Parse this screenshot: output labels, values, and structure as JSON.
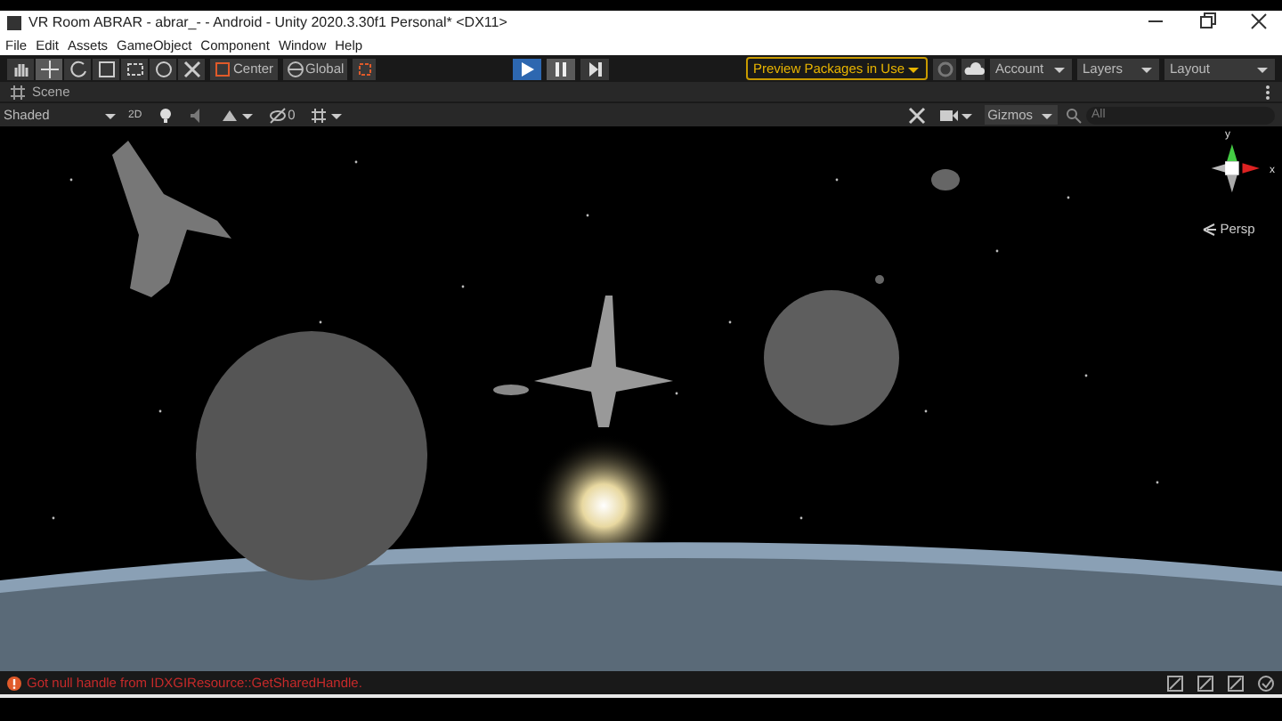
{
  "window": {
    "title": "VR Room ABRAR - abrar_- - Android - Unity 2020.3.30f1 Personal* <DX11>"
  },
  "menu": [
    "File",
    "Edit",
    "Assets",
    "GameObject",
    "Component",
    "Window",
    "Help"
  ],
  "toolbar": {
    "pivot": "Center",
    "space": "Global",
    "play": {
      "playing": true
    },
    "pause": {
      "paused": true
    },
    "preview_packages": "Preview Packages in Use",
    "account": "Account",
    "layers": "Layers",
    "layout": "Layout"
  },
  "scene_tab": {
    "label": "Scene"
  },
  "scene_toolbar": {
    "draw_mode": "Shaded",
    "mode_2d": "2D",
    "hidden_count": "0",
    "gizmos": "Gizmos",
    "search": {
      "placeholder": "All"
    }
  },
  "orientation_gizmo": {
    "y_label": "y",
    "x_label": "x",
    "projection": "Persp"
  },
  "status_bar": {
    "message": "Got null handle from IDXGIResource::GetSharedHandle."
  }
}
